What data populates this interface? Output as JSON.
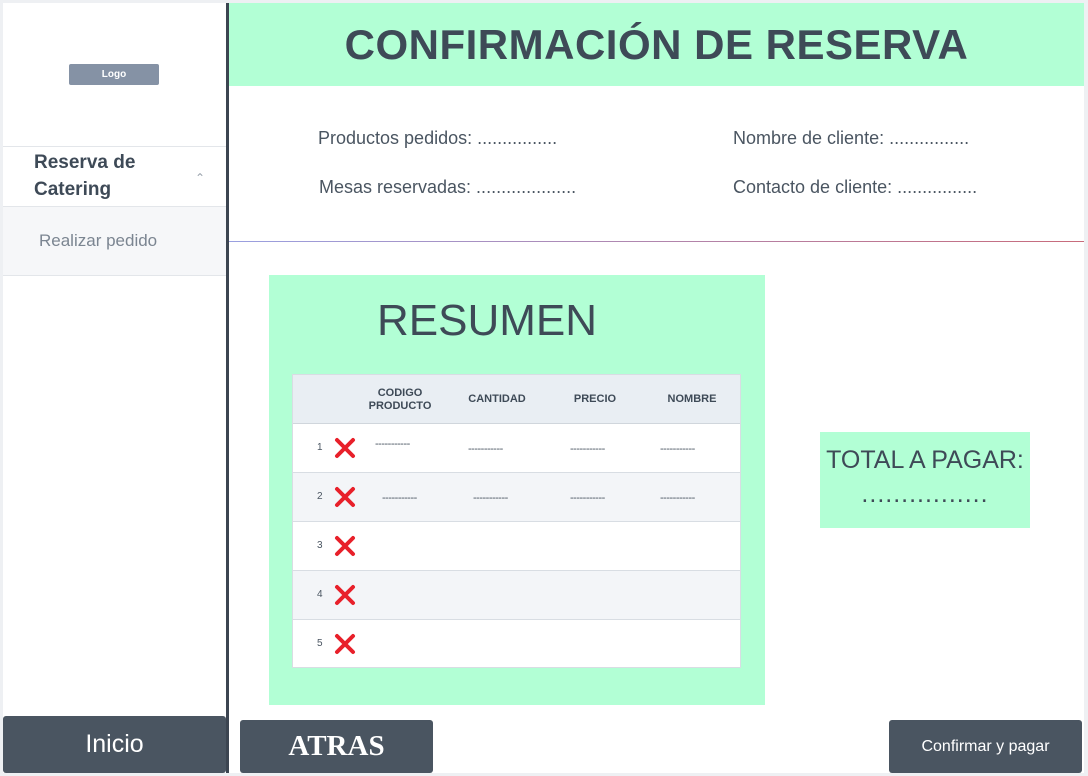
{
  "sidebar": {
    "logo_text": "Logo",
    "section_heading": "Reserva de Catering",
    "sub_item": "Realizar pedido",
    "home_button": "Inicio"
  },
  "header": {
    "title": "CONFIRMACIÓN DE RESERVA"
  },
  "info": {
    "products": "Productos pedidos: ................",
    "tables": "Mesas reservadas: ....................",
    "client_name": "Nombre de cliente: ................",
    "client_contact": "Contacto de cliente: ................"
  },
  "summary": {
    "title": "RESUMEN",
    "columns": [
      "CODIGO PRODUCTO",
      "CANTIDAD",
      "PRECIO",
      "NOMBRE"
    ],
    "rows": [
      {
        "num": "1",
        "cells": [
          "-----------",
          "-----------",
          "-----------",
          "-----------"
        ]
      },
      {
        "num": "2",
        "cells": [
          "-----------",
          "-----------",
          "-----------",
          "-----------"
        ]
      },
      {
        "num": "3",
        "cells": [
          "",
          "",
          "",
          ""
        ]
      },
      {
        "num": "4",
        "cells": [
          "",
          "",
          "",
          ""
        ]
      },
      {
        "num": "5",
        "cells": [
          "",
          "",
          "",
          ""
        ]
      }
    ]
  },
  "total": {
    "label": "TOTAL A PAGAR:",
    "value": "................"
  },
  "actions": {
    "back": "ATRAS",
    "confirm": "Confirmar y pagar"
  },
  "icons": {
    "delete": "close-x-icon"
  },
  "colors": {
    "accent_green": "#b2ffd5",
    "dark_button": "#4a5561",
    "delete_red": "#e8202a"
  }
}
